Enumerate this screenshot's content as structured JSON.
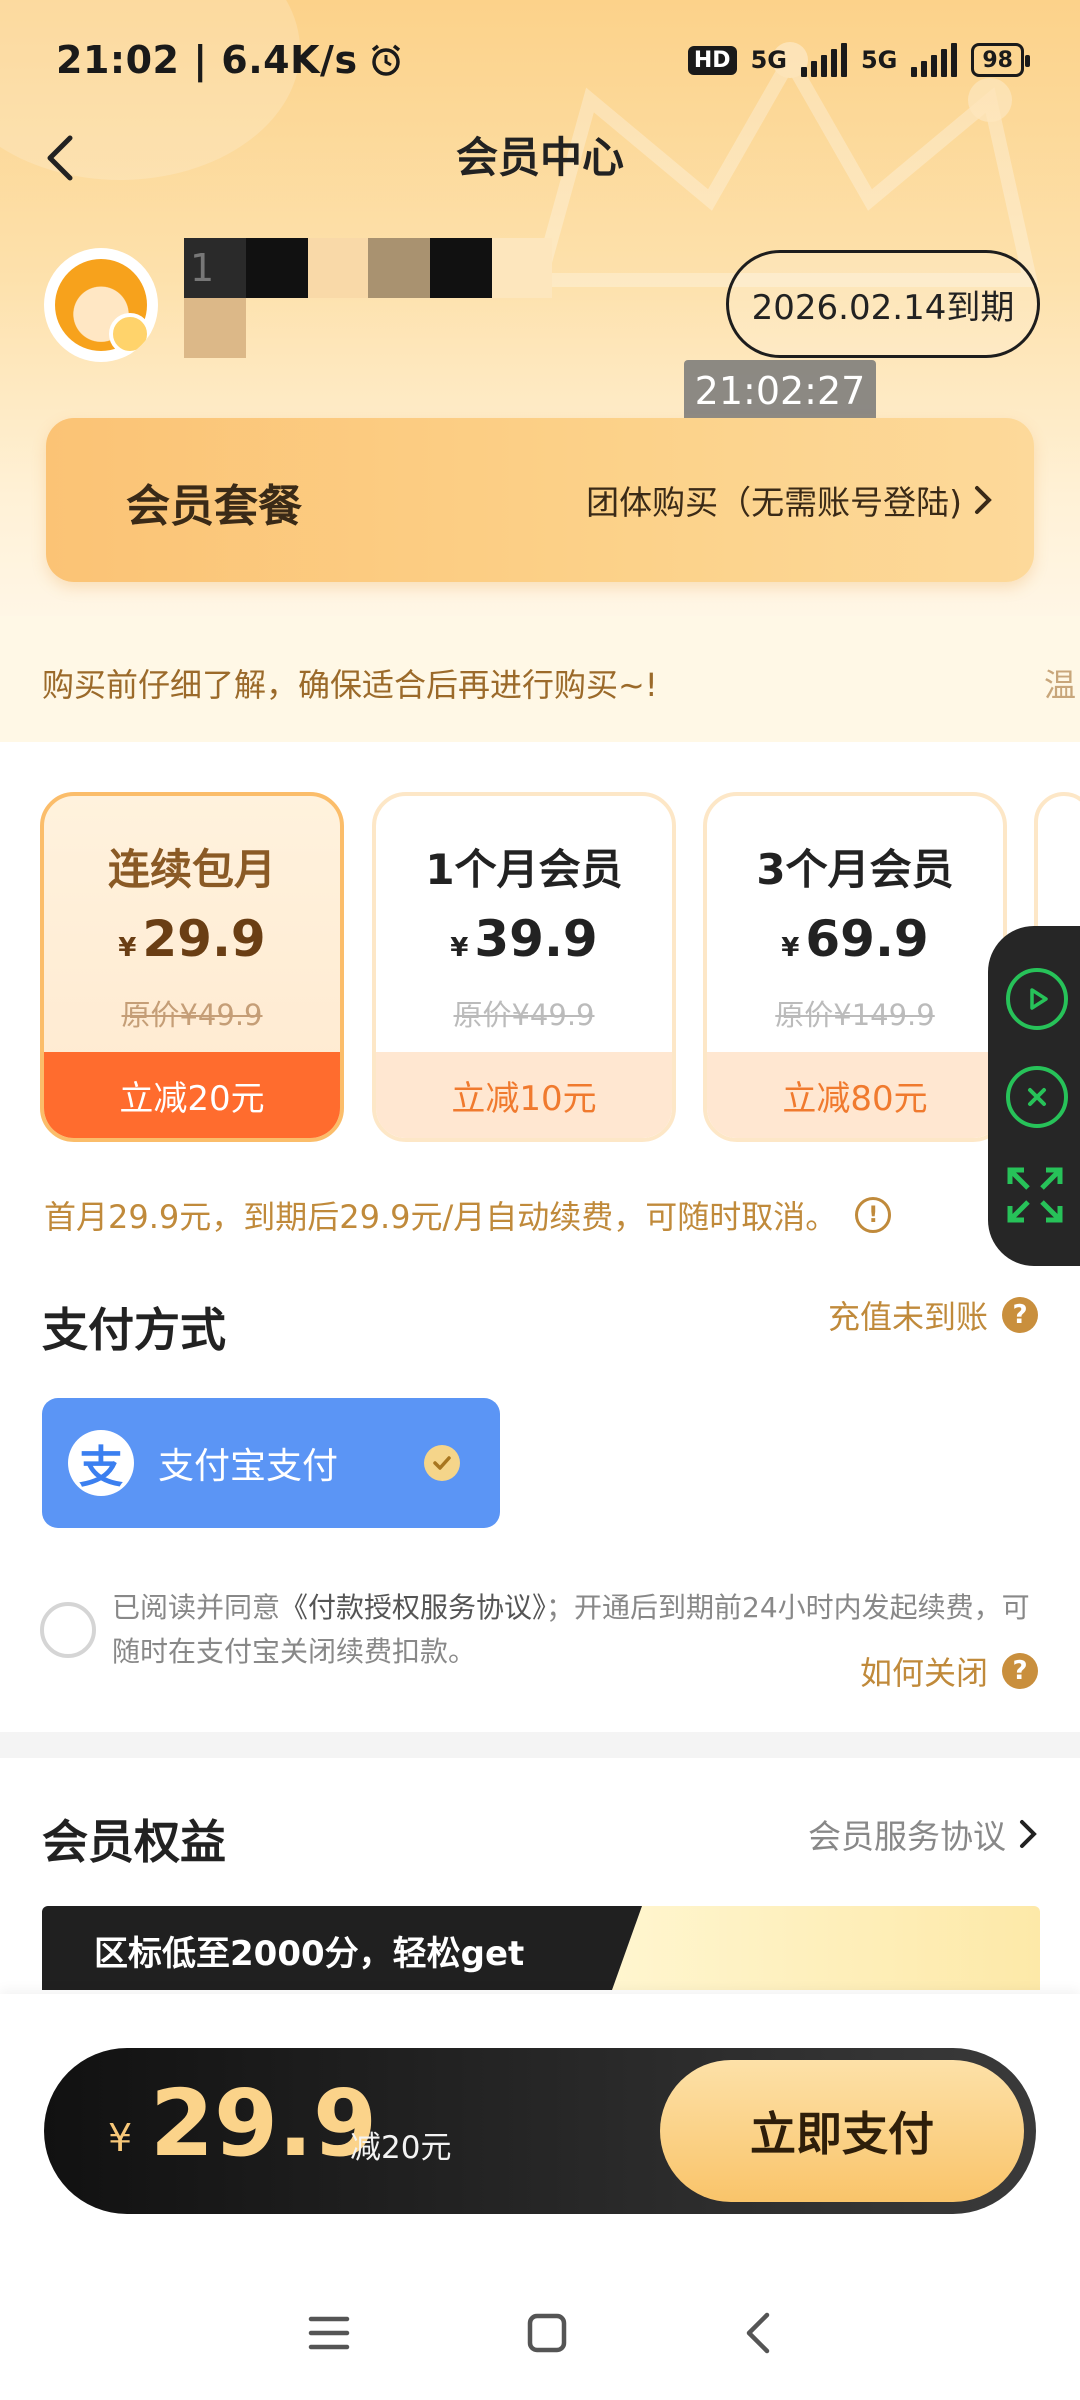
{
  "status_bar": {
    "time": "21:02 | 6.4K/s",
    "network_hd": "HD",
    "net1": "5G",
    "net2": "5G",
    "battery": "98"
  },
  "header": {
    "title": "会员中心"
  },
  "user": {
    "name_partial": "1",
    "expire_text": "2026.02.14到期",
    "clock_tip": "21:02:27"
  },
  "package": {
    "title": "会员套餐",
    "group_buy": "团体购买（无需账号登陆)"
  },
  "notice": {
    "text": "购买前仔细了解，确保适合后再进行购买~!",
    "text_next": "温"
  },
  "plans": [
    {
      "name": "连续包月",
      "currency": "¥",
      "price": "29.9",
      "original": "原价¥49.9",
      "discount": "立减20元",
      "selected": true
    },
    {
      "name": "1个月会员",
      "currency": "¥",
      "price": "39.9",
      "original": "原价¥49.9",
      "discount": "立减10元",
      "selected": false
    },
    {
      "name": "3个月会员",
      "currency": "¥",
      "price": "69.9",
      "original": "原价¥149.9",
      "discount": "立减80元",
      "selected": false
    }
  ],
  "autorenew_note": "首月29.9元，到期后29.9元/月自动续费，可随时取消。",
  "payment": {
    "title": "支付方式",
    "recharge_link": "充值未到账",
    "method_label": "支付宝支付",
    "method_logo": "支"
  },
  "agreement": {
    "prefix": "已阅读并同意",
    "link": "《付款授权服务协议》",
    "suffix": "；开通后到期前24小时内发起续费，可随时在支付宝关闭续费扣款。",
    "how_close": "如何关闭"
  },
  "benefits": {
    "title": "会员权益",
    "service_link": "会员服务协议",
    "banner_text": "区标低至2000分，轻松get"
  },
  "bottom": {
    "currency": "¥",
    "amount": "29.9",
    "save": "减20元",
    "pay_button": "立即支付"
  },
  "colors": {
    "accent_orange": "#ff6c2e",
    "gold": "#c08a3b",
    "alipay_blue": "#5b95f5",
    "float_green": "#27c259"
  }
}
